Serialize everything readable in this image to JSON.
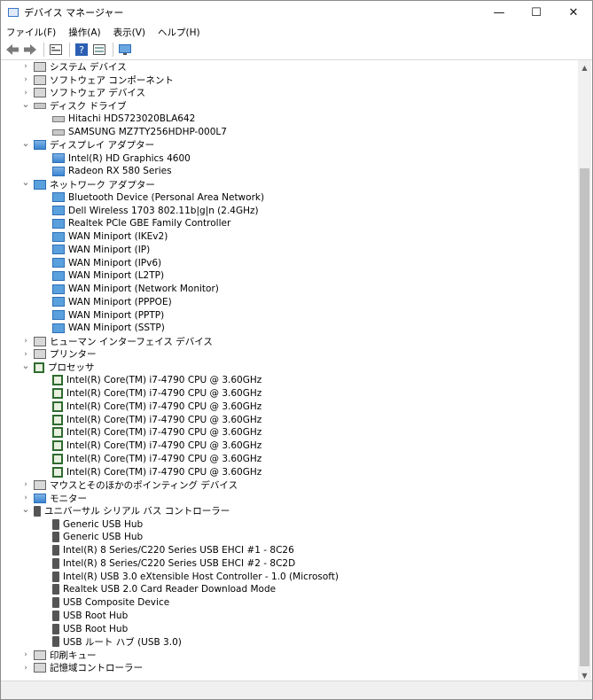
{
  "window": {
    "title": "デバイス マネージャー",
    "buttons": {
      "minimize": "—",
      "maximize": "☐",
      "close": "✕"
    }
  },
  "menu": [
    "ファイル(F)",
    "操作(A)",
    "表示(V)",
    "ヘルプ(H)"
  ],
  "toolbar": [
    "back-icon",
    "forward-icon",
    "properties-icon",
    "help-icon",
    "view-icon",
    "monitor-icon"
  ],
  "tree": [
    {
      "label": "システム デバイス",
      "level": 0,
      "expander": "collapsed",
      "icon": "system-icon"
    },
    {
      "label": "ソフトウェア コンポーネント",
      "level": 0,
      "expander": "collapsed",
      "icon": "software-component-icon"
    },
    {
      "label": "ソフトウェア デバイス",
      "level": 0,
      "expander": "collapsed",
      "icon": "software-device-icon"
    },
    {
      "label": "ディスク ドライブ",
      "level": 0,
      "expander": "expanded",
      "icon": "disk-drive-icon"
    },
    {
      "label": "Hitachi HDS723020BLA642",
      "level": 1,
      "icon": "disk-drive-icon"
    },
    {
      "label": "SAMSUNG MZ7TY256HDHP-000L7",
      "level": 1,
      "icon": "disk-drive-icon"
    },
    {
      "label": "ディスプレイ アダプター",
      "level": 0,
      "expander": "expanded",
      "icon": "display-adapter-icon"
    },
    {
      "label": "Intel(R) HD Graphics 4600",
      "level": 1,
      "icon": "display-adapter-icon"
    },
    {
      "label": "Radeon RX 580 Series",
      "level": 1,
      "icon": "display-adapter-icon"
    },
    {
      "label": "ネットワーク アダプター",
      "level": 0,
      "expander": "expanded",
      "icon": "network-adapter-icon"
    },
    {
      "label": "Bluetooth Device (Personal Area Network)",
      "level": 1,
      "icon": "network-adapter-icon"
    },
    {
      "label": "Dell Wireless 1703 802.11b|g|n (2.4GHz)",
      "level": 1,
      "icon": "network-adapter-icon"
    },
    {
      "label": "Realtek PCIe GBE Family Controller",
      "level": 1,
      "icon": "network-adapter-icon"
    },
    {
      "label": "WAN Miniport (IKEv2)",
      "level": 1,
      "icon": "network-adapter-icon"
    },
    {
      "label": "WAN Miniport (IP)",
      "level": 1,
      "icon": "network-adapter-icon"
    },
    {
      "label": "WAN Miniport (IPv6)",
      "level": 1,
      "icon": "network-adapter-icon"
    },
    {
      "label": "WAN Miniport (L2TP)",
      "level": 1,
      "icon": "network-adapter-icon"
    },
    {
      "label": "WAN Miniport (Network Monitor)",
      "level": 1,
      "icon": "network-adapter-icon"
    },
    {
      "label": "WAN Miniport (PPPOE)",
      "level": 1,
      "icon": "network-adapter-icon"
    },
    {
      "label": "WAN Miniport (PPTP)",
      "level": 1,
      "icon": "network-adapter-icon"
    },
    {
      "label": "WAN Miniport (SSTP)",
      "level": 1,
      "icon": "network-adapter-icon"
    },
    {
      "label": "ヒューマン インターフェイス デバイス",
      "level": 0,
      "expander": "collapsed",
      "icon": "hid-icon"
    },
    {
      "label": "プリンター",
      "level": 0,
      "expander": "collapsed",
      "icon": "printer-icon"
    },
    {
      "label": "プロセッサ",
      "level": 0,
      "expander": "expanded",
      "icon": "processor-icon"
    },
    {
      "label": "Intel(R) Core(TM) i7-4790 CPU @ 3.60GHz",
      "level": 1,
      "icon": "processor-icon"
    },
    {
      "label": "Intel(R) Core(TM) i7-4790 CPU @ 3.60GHz",
      "level": 1,
      "icon": "processor-icon"
    },
    {
      "label": "Intel(R) Core(TM) i7-4790 CPU @ 3.60GHz",
      "level": 1,
      "icon": "processor-icon"
    },
    {
      "label": "Intel(R) Core(TM) i7-4790 CPU @ 3.60GHz",
      "level": 1,
      "icon": "processor-icon"
    },
    {
      "label": "Intel(R) Core(TM) i7-4790 CPU @ 3.60GHz",
      "level": 1,
      "icon": "processor-icon"
    },
    {
      "label": "Intel(R) Core(TM) i7-4790 CPU @ 3.60GHz",
      "level": 1,
      "icon": "processor-icon"
    },
    {
      "label": "Intel(R) Core(TM) i7-4790 CPU @ 3.60GHz",
      "level": 1,
      "icon": "processor-icon"
    },
    {
      "label": "Intel(R) Core(TM) i7-4790 CPU @ 3.60GHz",
      "level": 1,
      "icon": "processor-icon"
    },
    {
      "label": "マウスとそのほかのポインティング デバイス",
      "level": 0,
      "expander": "collapsed",
      "icon": "mouse-icon"
    },
    {
      "label": "モニター",
      "level": 0,
      "expander": "collapsed",
      "icon": "monitor-icon"
    },
    {
      "label": "ユニバーサル シリアル バス コントローラー",
      "level": 0,
      "expander": "expanded",
      "icon": "usb-icon"
    },
    {
      "label": "Generic USB Hub",
      "level": 1,
      "icon": "usb-icon"
    },
    {
      "label": "Generic USB Hub",
      "level": 1,
      "icon": "usb-icon"
    },
    {
      "label": "Intel(R) 8 Series/C220 Series USB EHCI #1 - 8C26",
      "level": 1,
      "icon": "usb-icon"
    },
    {
      "label": "Intel(R) 8 Series/C220 Series USB EHCI #2 - 8C2D",
      "level": 1,
      "icon": "usb-icon"
    },
    {
      "label": "Intel(R) USB 3.0 eXtensible Host Controller - 1.0 (Microsoft)",
      "level": 1,
      "icon": "usb-icon"
    },
    {
      "label": "Realtek USB 2.0 Card Reader Download Mode",
      "level": 1,
      "icon": "usb-icon"
    },
    {
      "label": "USB Composite Device",
      "level": 1,
      "icon": "usb-icon"
    },
    {
      "label": "USB Root Hub",
      "level": 1,
      "icon": "usb-icon"
    },
    {
      "label": "USB Root Hub",
      "level": 1,
      "icon": "usb-icon"
    },
    {
      "label": "USB ルート ハブ (USB 3.0)",
      "level": 1,
      "icon": "usb-icon"
    },
    {
      "label": "印刷キュー",
      "level": 0,
      "expander": "collapsed",
      "icon": "print-queue-icon"
    },
    {
      "label": "記憶域コントローラー",
      "level": 0,
      "expander": "collapsed",
      "icon": "storage-controller-icon"
    }
  ],
  "scrollbar": {
    "up": "▲",
    "down": "▼",
    "position": 0.17
  }
}
